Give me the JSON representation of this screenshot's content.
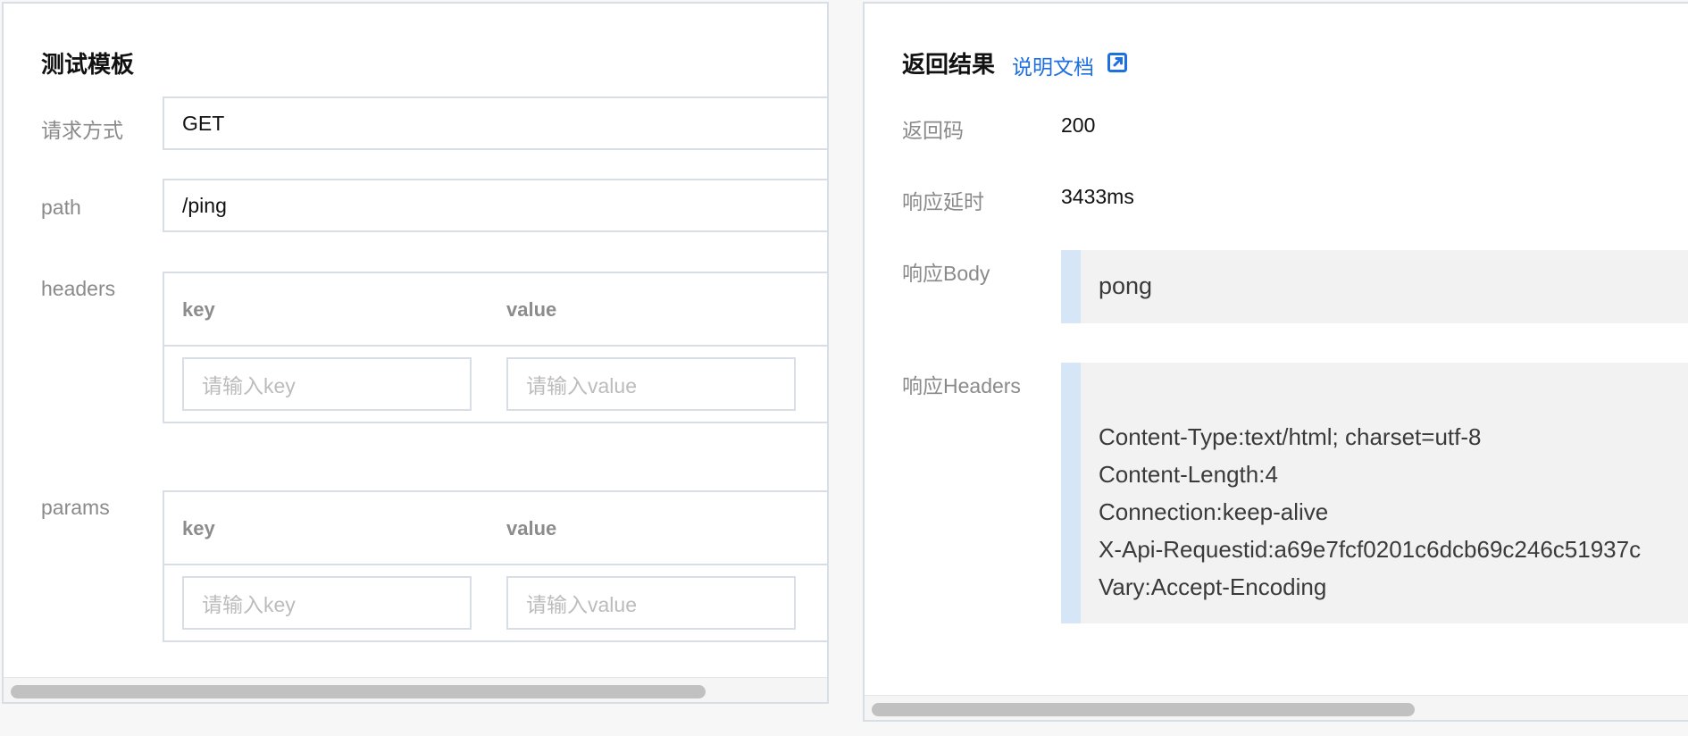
{
  "left": {
    "title": "测试模板",
    "method": {
      "label": "请求方式",
      "value": "GET"
    },
    "path": {
      "label": "path",
      "value": "/ping"
    },
    "headers": {
      "label": "headers",
      "col_key": "key",
      "col_value": "value",
      "key_placeholder": "请输入key",
      "value_placeholder": "请输入value"
    },
    "params": {
      "label": "params",
      "col_key": "key",
      "col_value": "value",
      "key_placeholder": "请输入key",
      "value_placeholder": "请输入value"
    }
  },
  "right": {
    "title": "返回结果",
    "doc_link": "说明文档",
    "status": {
      "label": "返回码",
      "value": "200"
    },
    "latency": {
      "label": "响应延时",
      "value": "3433ms"
    },
    "body": {
      "label": "响应Body",
      "value": "pong"
    },
    "headers": {
      "label": "响应Headers",
      "lines": [
        "Content-Type:text/html; charset=utf-8",
        "Content-Length:4",
        "Connection:keep-alive",
        "X-Api-Requestid:a69e7fcf0201c6dcb69c246c51937c",
        "Vary:Accept-Encoding"
      ]
    }
  },
  "colors": {
    "accent": "#1e6fe0",
    "border": "#d9dde6",
    "code_bar": "#d6e6f7"
  },
  "icons": {
    "external_link": "external-link-icon"
  }
}
